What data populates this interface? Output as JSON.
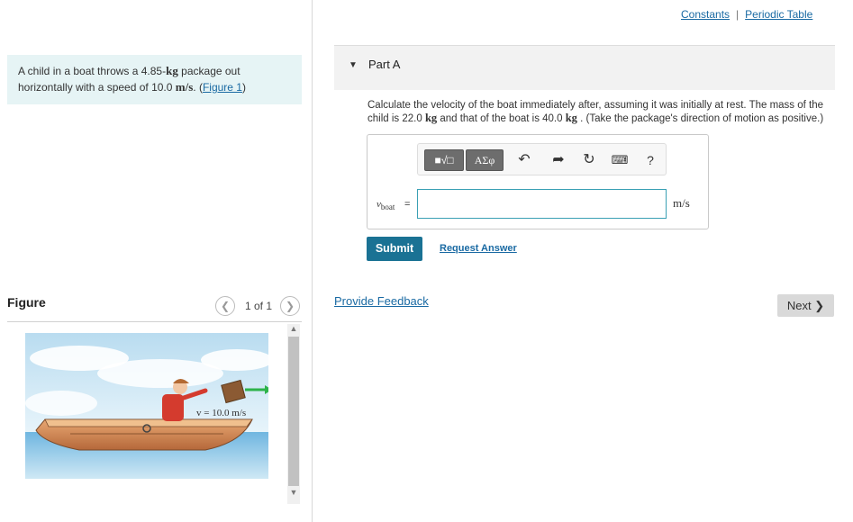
{
  "header_links": {
    "constants": "Constants",
    "separator": "|",
    "periodic_table": "Periodic Table"
  },
  "problem": {
    "text_1": "A child in a boat throws a 4.85-",
    "unit_kg": "kg",
    "text_2": " package out horizontally with a speed of 10.0 ",
    "unit_ms": "m/s",
    "text_3": ". (",
    "figure_link": "Figure 1",
    "text_4": ")"
  },
  "figure": {
    "title": "Figure",
    "pager": "1 of 1",
    "velocity_label": "v = 10.0 m/s"
  },
  "part": {
    "title": "Part A",
    "question_1": "Calculate the velocity of the boat immediately after, assuming it was initially at rest. The mass of the child is 22.0 ",
    "kg_1": "kg",
    "question_2": " and that of the boat is 40.0 ",
    "kg_2": "kg",
    "question_3": " . (Take the package's direction of motion as positive.)",
    "variable": "v",
    "variable_sub": "boat",
    "equals": "=",
    "input_value": "",
    "unit": "m/s",
    "toolbar": {
      "templates": "■√□",
      "greek": "ΑΣφ",
      "help": "?"
    }
  },
  "actions": {
    "submit": "Submit",
    "request_answer": "Request Answer",
    "provide_feedback": "Provide Feedback",
    "next": "Next ❯"
  },
  "colors": {
    "accent": "#1a7294",
    "link": "#1a6aa3",
    "problem_bg": "#e6f4f5",
    "arrow": "#2db34a"
  },
  "icons": [
    "undo-icon",
    "redo-icon",
    "reset-icon",
    "keyboard-icon",
    "help-icon",
    "caret-down-icon",
    "chevron-left-icon",
    "chevron-right-icon"
  ]
}
